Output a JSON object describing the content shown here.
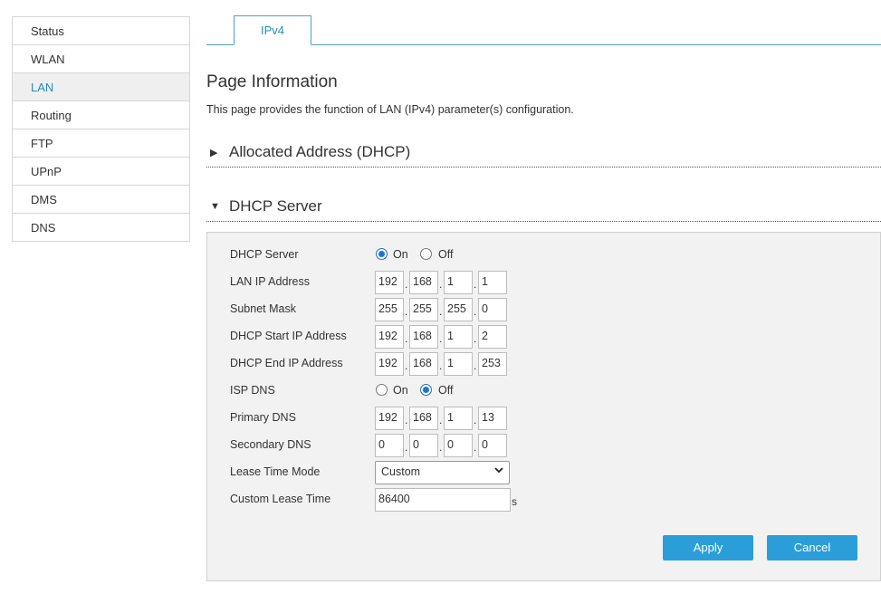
{
  "sidebar": {
    "items": [
      {
        "label": "Status"
      },
      {
        "label": "WLAN"
      },
      {
        "label": "LAN",
        "active": true
      },
      {
        "label": "Routing"
      },
      {
        "label": "FTP"
      },
      {
        "label": "UPnP"
      },
      {
        "label": "DMS"
      },
      {
        "label": "DNS"
      }
    ]
  },
  "tabs": [
    {
      "label": "IPv4"
    }
  ],
  "page": {
    "title": "Page Information",
    "description": "This page provides the function of LAN (IPv4) parameter(s) configuration."
  },
  "sections": {
    "allocated": {
      "label": "Allocated Address (DHCP)",
      "arrow": "▶"
    },
    "dhcp_server": {
      "label": "DHCP Server",
      "arrow": "▼"
    }
  },
  "form": {
    "dhcp_server": {
      "label": "DHCP Server",
      "on_label": "On",
      "off_label": "Off",
      "value": "On"
    },
    "lan_ip": {
      "label": "LAN IP Address",
      "octets": [
        "192",
        "168",
        "1",
        "1"
      ]
    },
    "subnet_mask": {
      "label": "Subnet Mask",
      "octets": [
        "255",
        "255",
        "255",
        "0"
      ]
    },
    "start_ip": {
      "label": "DHCP Start IP Address",
      "octets": [
        "192",
        "168",
        "1",
        "2"
      ]
    },
    "end_ip": {
      "label": "DHCP End IP Address",
      "octets": [
        "192",
        "168",
        "1",
        "253"
      ]
    },
    "isp_dns": {
      "label": "ISP DNS",
      "on_label": "On",
      "off_label": "Off",
      "value": "Off"
    },
    "primary_dns": {
      "label": "Primary DNS",
      "octets": [
        "192",
        "168",
        "1",
        "13"
      ]
    },
    "secondary_dns": {
      "label": "Secondary DNS",
      "octets": [
        "0",
        "0",
        "0",
        "0"
      ]
    },
    "lease_mode": {
      "label": "Lease Time Mode",
      "value": "Custom"
    },
    "lease_time": {
      "label": "Custom Lease Time",
      "value": "86400",
      "unit": "s"
    }
  },
  "buttons": {
    "apply": "Apply",
    "cancel": "Cancel"
  },
  "colors": {
    "accent": "#2b9ed9",
    "tab_border": "#4aa3c8",
    "active_text": "#2b8ab8"
  }
}
